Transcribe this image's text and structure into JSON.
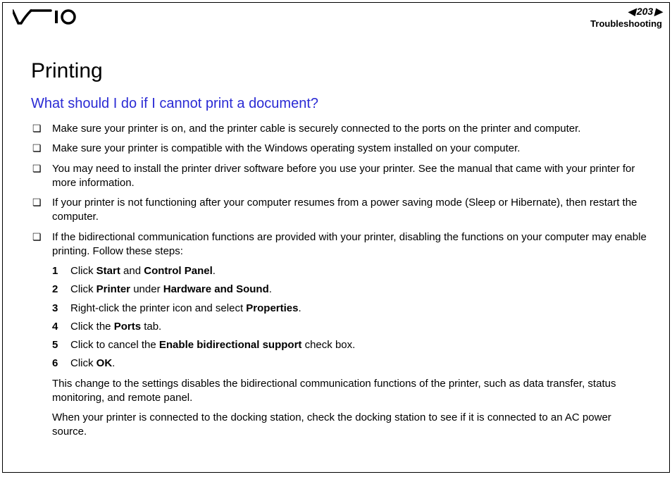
{
  "header": {
    "page_number": "203",
    "section": "Troubleshooting"
  },
  "title": "Printing",
  "subtitle": "What should I do if I cannot print a document?",
  "bullets": [
    "Make sure your printer is on, and the printer cable is securely connected to the ports on the printer and computer.",
    "Make sure your printer is compatible with the Windows operating system installed on your computer.",
    "You may need to install the printer driver software before you use your printer. See the manual that came with your printer for more information.",
    "If your printer is not functioning after your computer resumes from a power saving mode (Sleep or Hibernate), then restart the computer.",
    "If the bidirectional communication functions are provided with your printer, disabling the functions on your computer may enable printing. Follow these steps:"
  ],
  "steps": [
    {
      "n": "1",
      "prefix": "Click ",
      "b1": "Start",
      "mid": " and ",
      "b2": "Control Panel",
      "suffix": "."
    },
    {
      "n": "2",
      "prefix": "Click ",
      "b1": "Printer",
      "mid": " under ",
      "b2": "Hardware and Sound",
      "suffix": "."
    },
    {
      "n": "3",
      "prefix": "Right-click the printer icon and select ",
      "b1": "Properties",
      "mid": "",
      "b2": "",
      "suffix": "."
    },
    {
      "n": "4",
      "prefix": "Click the ",
      "b1": "Ports",
      "mid": "",
      "b2": "",
      "suffix": " tab."
    },
    {
      "n": "5",
      "prefix": "Click to cancel the ",
      "b1": "Enable bidirectional support",
      "mid": "",
      "b2": "",
      "suffix": " check box."
    },
    {
      "n": "6",
      "prefix": "Click ",
      "b1": "OK",
      "mid": "",
      "b2": "",
      "suffix": "."
    }
  ],
  "closing": [
    "This change to the settings disables the bidirectional communication functions of the printer, such as data transfer, status monitoring, and remote panel.",
    "When your printer is connected to the docking station, check the docking station to see if it is connected to an AC power source."
  ]
}
